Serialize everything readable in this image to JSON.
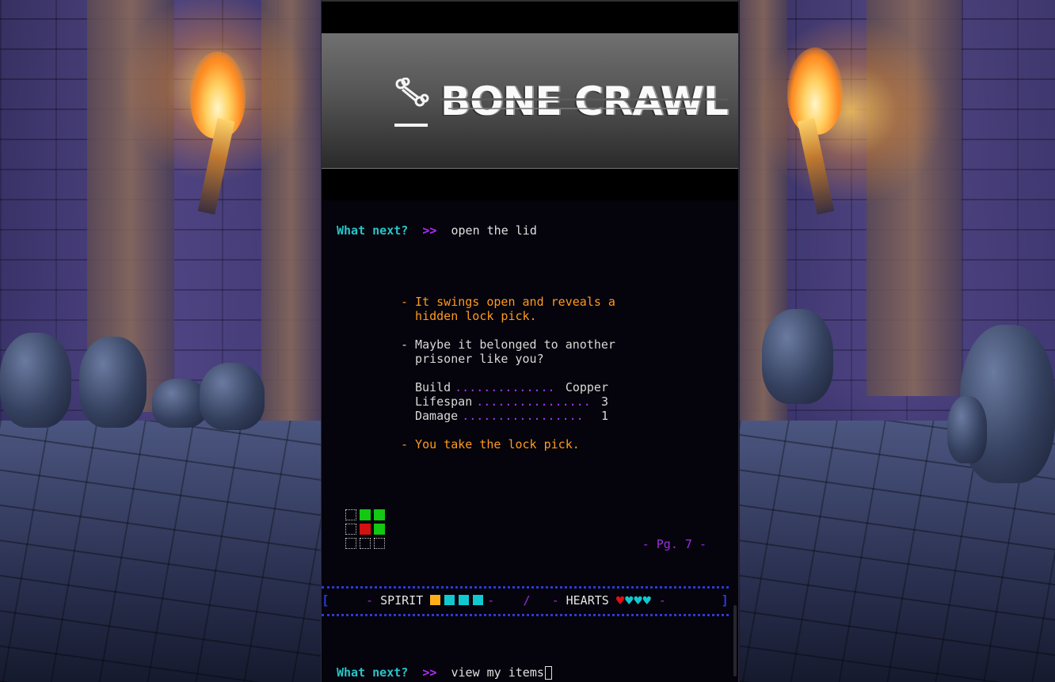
{
  "game": {
    "title": "BONE CRAWL",
    "logo_icon": "bone-icon"
  },
  "prompt": {
    "label": "What next?",
    "arrows": ">>",
    "previous_command": "open the lid",
    "current_command": "view my items"
  },
  "output": {
    "line1a": "- It swings open and reveals a",
    "line1b": "  hidden lock pick.",
    "line2a": "- Maybe it belonged to another",
    "line2b": "  prisoner like you?",
    "line3": "- You take the lock pick."
  },
  "item_stats": [
    {
      "label": "Build",
      "dots": "..............",
      "value": "Copper"
    },
    {
      "label": "Lifespan",
      "dots": "................",
      "value": "3"
    },
    {
      "label": "Damage",
      "dots": ".................",
      "value": "1"
    }
  ],
  "minimap": {
    "cells": [
      "empty",
      "green",
      "green",
      "empty",
      "red",
      "green",
      "empty",
      "empty",
      "empty"
    ]
  },
  "page": {
    "text": "- Pg. 7 -"
  },
  "status": {
    "left_bracket": "[",
    "right_bracket": "]",
    "spirit_label": "SPIRIT",
    "spirit_total": 4,
    "spirit_filled_orange": 1,
    "separator": "/",
    "hearts_label": "HEARTS",
    "hearts_total": 4,
    "hearts_red": 1,
    "dash": "-"
  },
  "colors": {
    "prompt": "#27c5c9",
    "arrows": "#b22cff",
    "narration_orange": "#ff9a1f",
    "dots": "#a638ff",
    "status_border": "#2a3bd6"
  }
}
